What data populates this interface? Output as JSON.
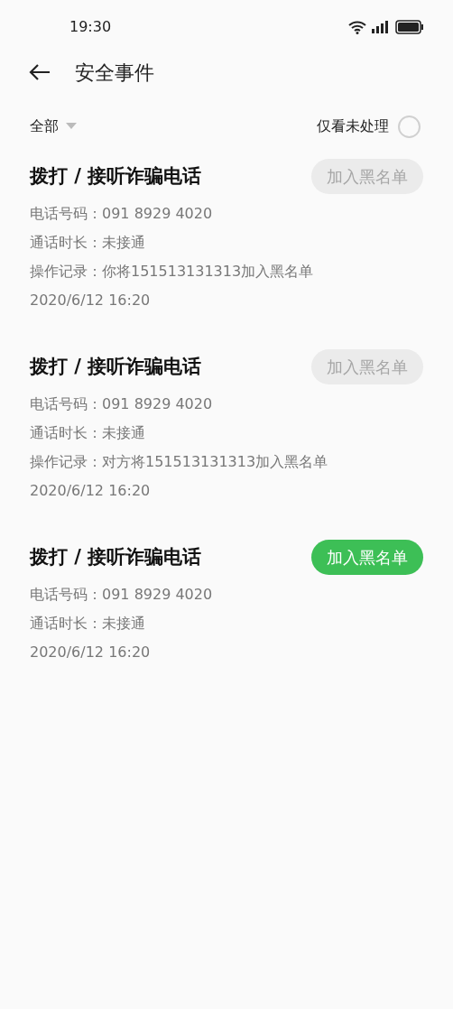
{
  "status_bar": {
    "time": "19:30"
  },
  "header": {
    "title": "安全事件"
  },
  "filter": {
    "dropdown": "全部",
    "toggle_label": "仅看未处理",
    "toggle_checked": false
  },
  "events": [
    {
      "title": "拨打 / 接听诈骗电话",
      "button": "加入黑名单",
      "disabled": true,
      "lines": [
        "电话号码：091 8929 4020",
        "通话时长：未接通",
        "操作记录：你将151513131313加入黑名单",
        "2020/6/12  16:20"
      ]
    },
    {
      "title": "拨打 / 接听诈骗电话",
      "button": "加入黑名单",
      "disabled": true,
      "lines": [
        "电话号码：091 8929 4020",
        "通话时长：未接通",
        "操作记录：对方将151513131313加入黑名单",
        "2020/6/12  16:20"
      ]
    },
    {
      "title": "拨打 / 接听诈骗电话",
      "button": "加入黑名单",
      "disabled": false,
      "lines": [
        "电话号码：091 8929 4020",
        "通话时长：未接通",
        "2020/6/12  16:20"
      ]
    }
  ]
}
